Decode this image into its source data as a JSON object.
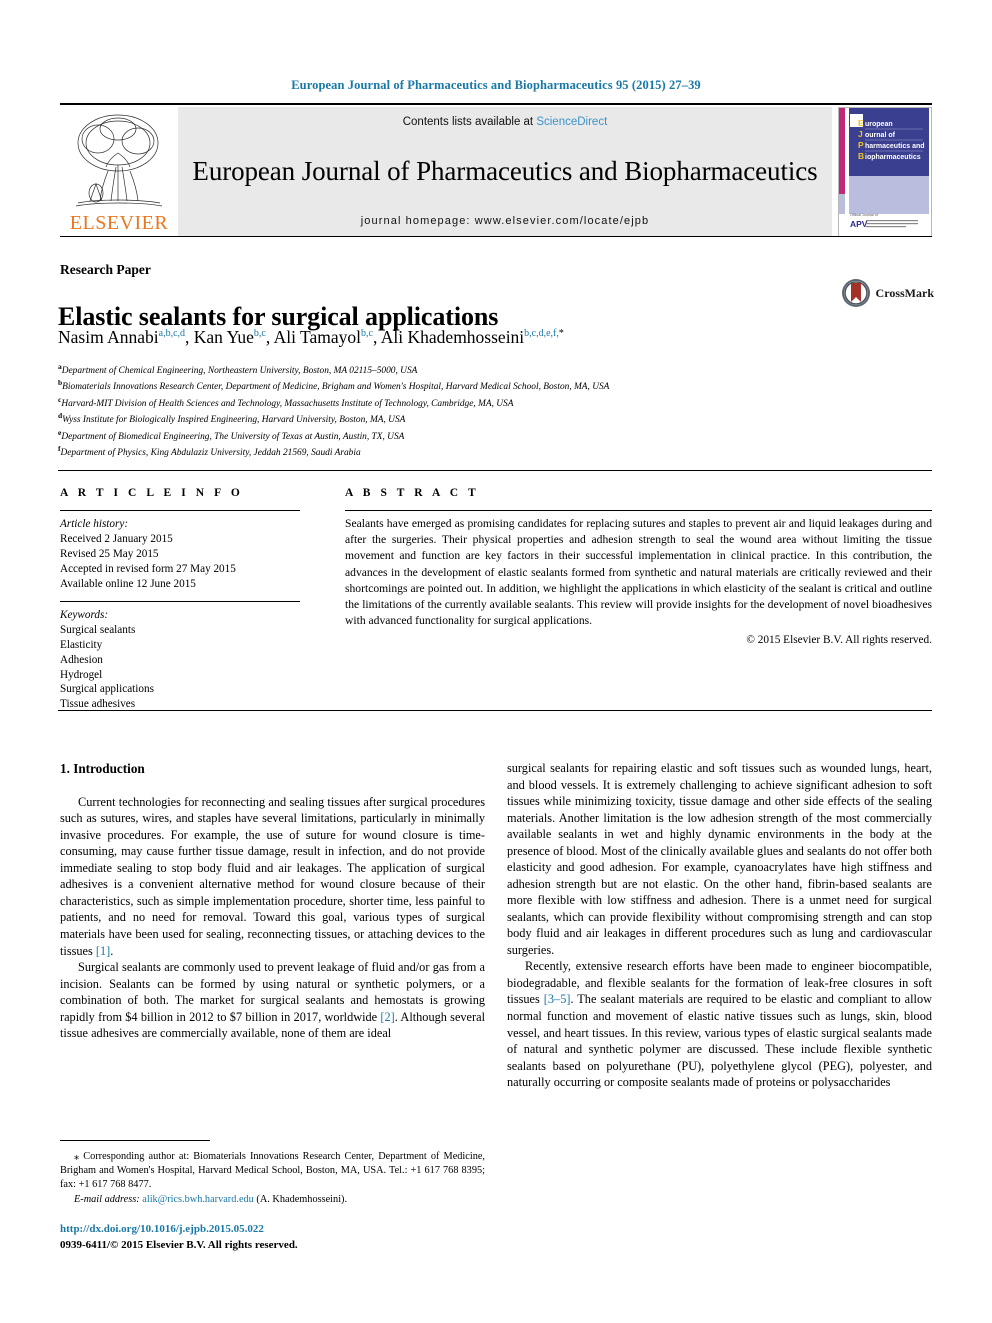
{
  "running_head": "European Journal of Pharmaceutics and Biopharmaceutics 95 (2015) 27–39",
  "masthead": {
    "contents_prefix": "Contents lists available at ",
    "contents_link": "ScienceDirect",
    "journal_title": "European Journal of Pharmaceutics and Biopharmaceutics",
    "homepage": "journal homepage: www.elsevier.com/locate/ejpb",
    "publisher": "ELSEVIER",
    "cover_title_lines": [
      "uropean",
      "ournal of",
      "harmaceutics and",
      "iopharmaceutics"
    ],
    "cover_caps": [
      "E",
      "J",
      "P",
      "B"
    ],
    "cover_footer": "Official Journal of",
    "cover_footer_mark": "APV"
  },
  "article": {
    "kicker": "Research Paper",
    "title": "Elastic sealants for surgical applications",
    "crossmark_label": "CrossMark",
    "authors": [
      {
        "name": "Nasim Annabi",
        "sup": "a,b,c,d",
        "sep": ", "
      },
      {
        "name": "Kan Yue",
        "sup": "b,c",
        "sep": ", "
      },
      {
        "name": "Ali Tamayol",
        "sup": "b,c",
        "sep": ", "
      },
      {
        "name": "Ali Khademhosseini",
        "sup": "b,c,d,e,f,",
        "star": "*",
        "sep": ""
      }
    ],
    "affiliations": [
      {
        "mark": "a",
        "text": "Department of Chemical Engineering, Northeastern University, Boston, MA 02115–5000, USA"
      },
      {
        "mark": "b",
        "text": "Biomaterials Innovations Research Center, Department of Medicine, Brigham and Women's Hospital, Harvard Medical School, Boston, MA, USA"
      },
      {
        "mark": "c",
        "text": "Harvard-MIT Division of Health Sciences and Technology, Massachusetts Institute of Technology, Cambridge, MA, USA"
      },
      {
        "mark": "d",
        "text": "Wyss Institute for Biologically Inspired Engineering, Harvard University, Boston, MA, USA"
      },
      {
        "mark": "e",
        "text": "Department of Biomedical Engineering, The University of Texas at Austin, Austin, TX, USA"
      },
      {
        "mark": "f",
        "text": "Department of Physics, King Abdulaziz University, Jeddah 21569, Saudi Arabia"
      }
    ]
  },
  "info": {
    "heading_article_info": "A R T I C L E   I N F O",
    "heading_abstract": "A B S T R A C T",
    "history_label": "Article history:",
    "history": [
      "Received 2 January 2015",
      "Revised 25 May 2015",
      "Accepted in revised form 27 May 2015",
      "Available online 12 June 2015"
    ],
    "keywords_label": "Keywords:",
    "keywords": [
      "Surgical sealants",
      "Elasticity",
      "Adhesion",
      "Hydrogel",
      "Surgical applications",
      "Tissue adhesives"
    ]
  },
  "abstract": {
    "text": "Sealants have emerged as promising candidates for replacing sutures and staples to prevent air and liquid leakages during and after the surgeries. Their physical properties and adhesion strength to seal the wound area without limiting the tissue movement and function are key factors in their successful implementation in clinical practice. In this contribution, the advances in the development of elastic sealants formed from synthetic and natural materials are critically reviewed and their shortcomings are pointed out. In addition, we highlight the applications in which elasticity of the sealant is critical and outline the limitations of the currently available sealants. This review will provide insights for the development of novel bioadhesives with advanced functionality for surgical applications.",
    "copyright": "© 2015 Elsevier B.V. All rights reserved."
  },
  "body": {
    "section_heading": "1. Introduction",
    "left_paragraphs": [
      {
        "pre": "Current technologies for reconnecting and sealing tissues after surgical procedures such as sutures, wires, and staples have several limitations, particularly in minimally invasive procedures. For example, the use of suture for wound closure is time-consuming, may cause further tissue damage, result in infection, and do not provide immediate sealing to stop body fluid and air leakages. The application of surgical adhesives is a convenient alternative method for wound closure because of their characteristics, such as simple implementation procedure, shorter time, less painful to patients, and no need for removal. Toward this goal, various types of surgical materials have been used for sealing, reconnecting tissues, or attaching devices to the tissues ",
        "ref": "[1]",
        "post": "."
      },
      {
        "pre": "Surgical sealants are commonly used to prevent leakage of fluid and/or gas from a incision. Sealants can be formed by using natural or synthetic polymers, or a combination of both. The market for surgical sealants and hemostats is growing rapidly from $4 billion in 2012 to $7 billion in 2017, worldwide ",
        "ref": "[2]",
        "post": ". Although several tissue adhesives are commercially available, none of them are ideal"
      }
    ],
    "right_paragraphs": [
      {
        "pre": "surgical sealants for repairing elastic and soft tissues such as wounded lungs, heart, and blood vessels. It is extremely challenging to achieve significant adhesion to soft tissues while minimizing toxicity, tissue damage and other side effects of the sealing materials. Another limitation is the low adhesion strength of the most commercially available sealants in wet and highly dynamic environments in the body at the presence of blood. Most of the clinically available glues and sealants do not offer both elasticity and good adhesion. For example, cyanoacrylates have high stiffness and adhesion strength but are not elastic. On the other hand, fibrin-based sealants are more flexible with low stiffness and adhesion. There is a unmet need for surgical sealants, which can provide flexibility without compromising strength and can stop body fluid and air leakages in different procedures such as lung and cardiovascular surgeries.",
        "ref": "",
        "post": "",
        "no_indent": false
      },
      {
        "pre": "Recently, extensive research efforts have been made to engineer biocompatible, biodegradable, and flexible sealants for the formation of leak-free closures in soft tissues ",
        "ref": "[3–5]",
        "post": ". The sealant materials are required to be elastic and compliant to allow normal function and movement of elastic native tissues such as lungs, skin, blood vessel, and heart tissues. In this review, various types of elastic surgical sealants made of natural and synthetic polymer are discussed. These include flexible synthetic sealants based on polyurethane (PU), polyethylene glycol (PEG), polyester, and naturally occurring or composite sealants made of proteins or polysaccharides"
      }
    ]
  },
  "footer": {
    "corresponding_marker": "⁎",
    "corresponding_text": " Corresponding author at: Biomaterials Innovations Research Center, Department of Medicine, Brigham and Women's Hospital, Harvard Medical School, Boston, MA, USA. Tel.: +1 617 768 8395; fax: +1 617 768 8477.",
    "email_label": "E-mail address:",
    "email": "alik@rics.bwh.harvard.edu",
    "email_owner": " (A. Khademhosseini).",
    "doi": "http://dx.doi.org/10.1016/j.ejpb.2015.05.022",
    "issn_line": "0939-6411/© 2015 Elsevier B.V. All rights reserved."
  },
  "colors": {
    "link": "#1878a8",
    "sciencedirect": "#3a93c9",
    "elsevier_orange": "#e87722",
    "band_gray": "#e9e9e9",
    "cover_blue": "#3b3f8f",
    "crossmark_red": "#a33229"
  }
}
